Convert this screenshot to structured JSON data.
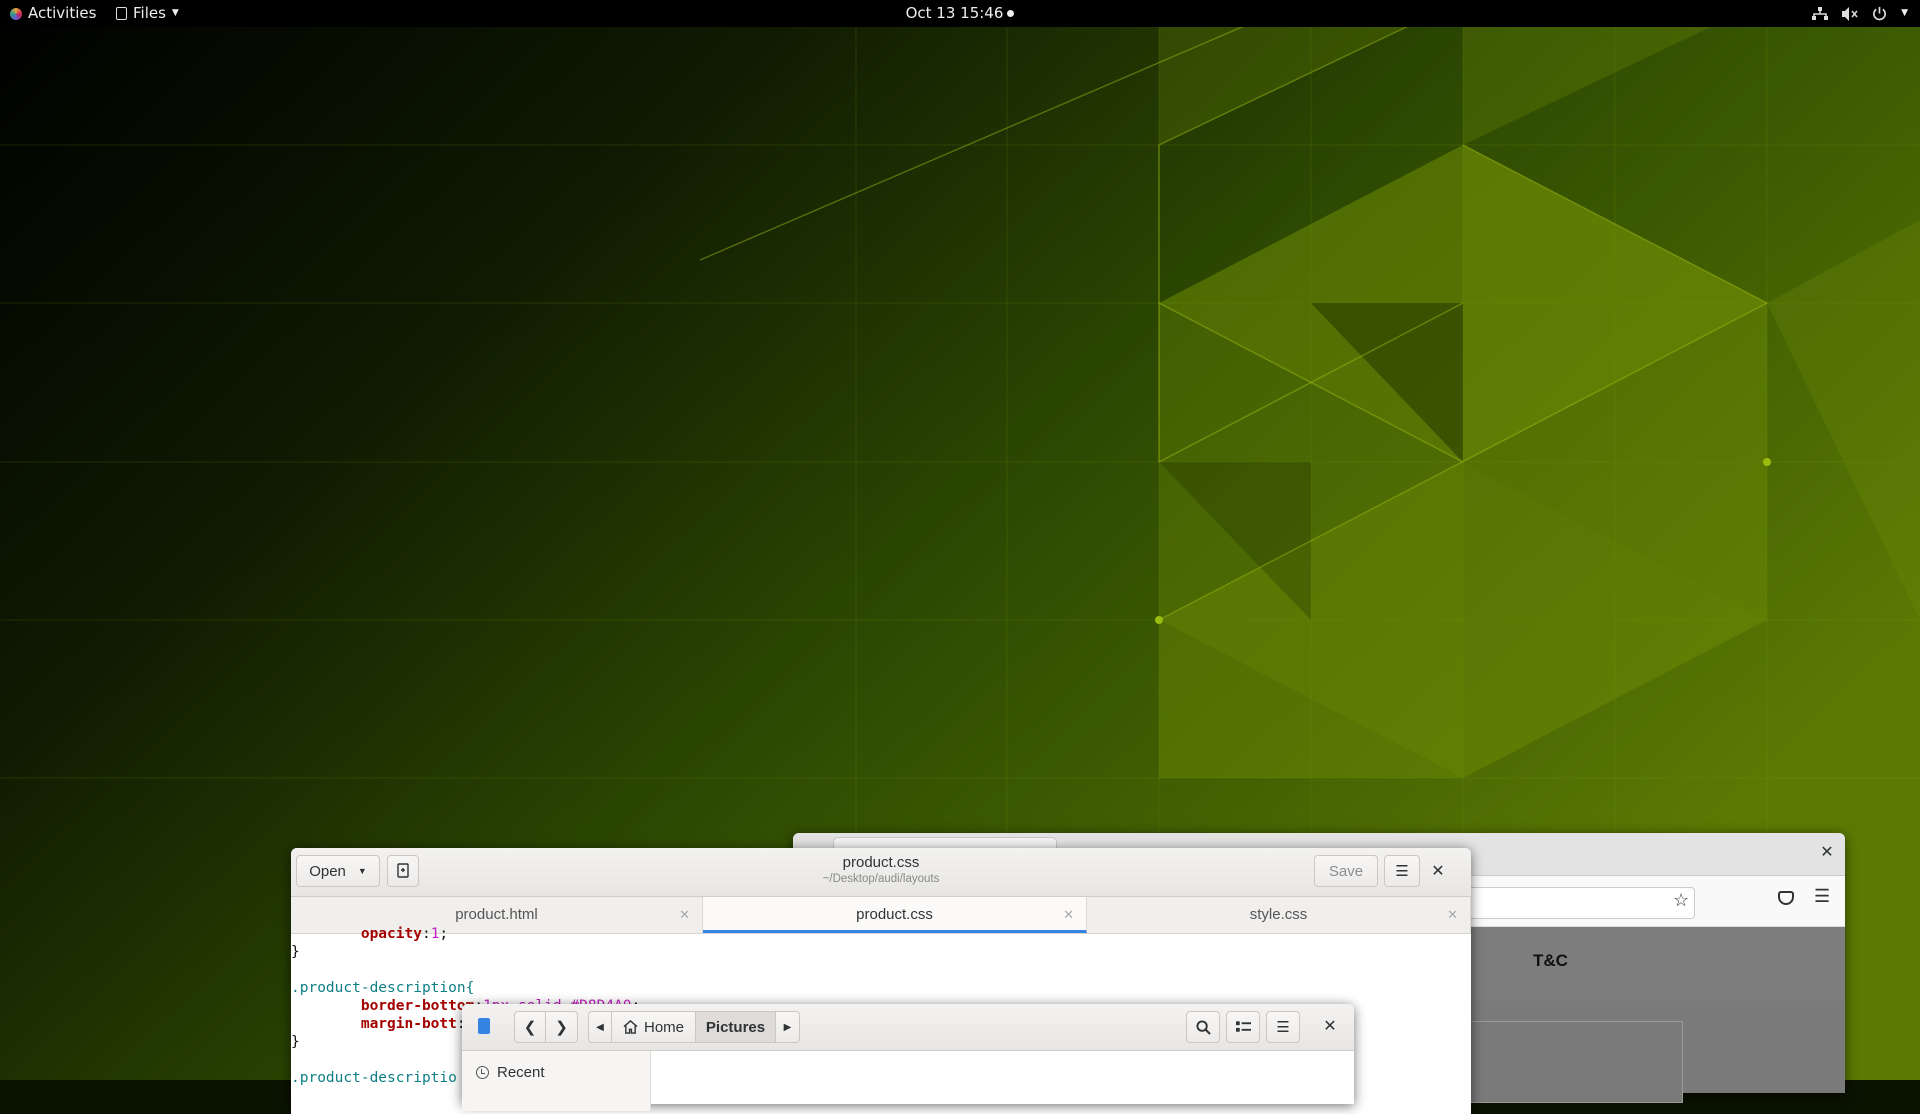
{
  "topbar": {
    "activities": "Activities",
    "app_menu": "Files",
    "clock": "Oct 13  15:46"
  },
  "browser": {
    "page_link": "T&C"
  },
  "editor": {
    "open_label": "Open",
    "save_label": "Save",
    "title": "product.css",
    "subtitle": "~/Desktop/audi/layouts",
    "tabs": [
      {
        "label": "product.html"
      },
      {
        "label": "product.css"
      },
      {
        "label": "style.css"
      }
    ],
    "active_tab": "product.css",
    "code_lines": [
      {
        "indent": "        ",
        "prop": "opacity",
        "value": "1",
        "sel": ""
      },
      {
        "text": "}"
      },
      {
        "text": ""
      },
      {
        "sel_text": ".product-description{"
      },
      {
        "indent": "        ",
        "prop": "border-bottom",
        "value": "1px solid #D8D4A0",
        "sel": ""
      },
      {
        "indent": "        ",
        "prop": "margin-bott",
        "value": "",
        "sel": ""
      },
      {
        "text": "}"
      },
      {
        "text": ""
      },
      {
        "sel_text": ".product-descriptio"
      }
    ]
  },
  "chooser": {
    "home_label": "Home",
    "pictures_label": "Pictures",
    "sidebar_recent": "Recent"
  },
  "colors": {
    "accent": "#3584e4",
    "wallpaper_dark": "#0a1200",
    "wallpaper_bright": "#6d8c05"
  }
}
